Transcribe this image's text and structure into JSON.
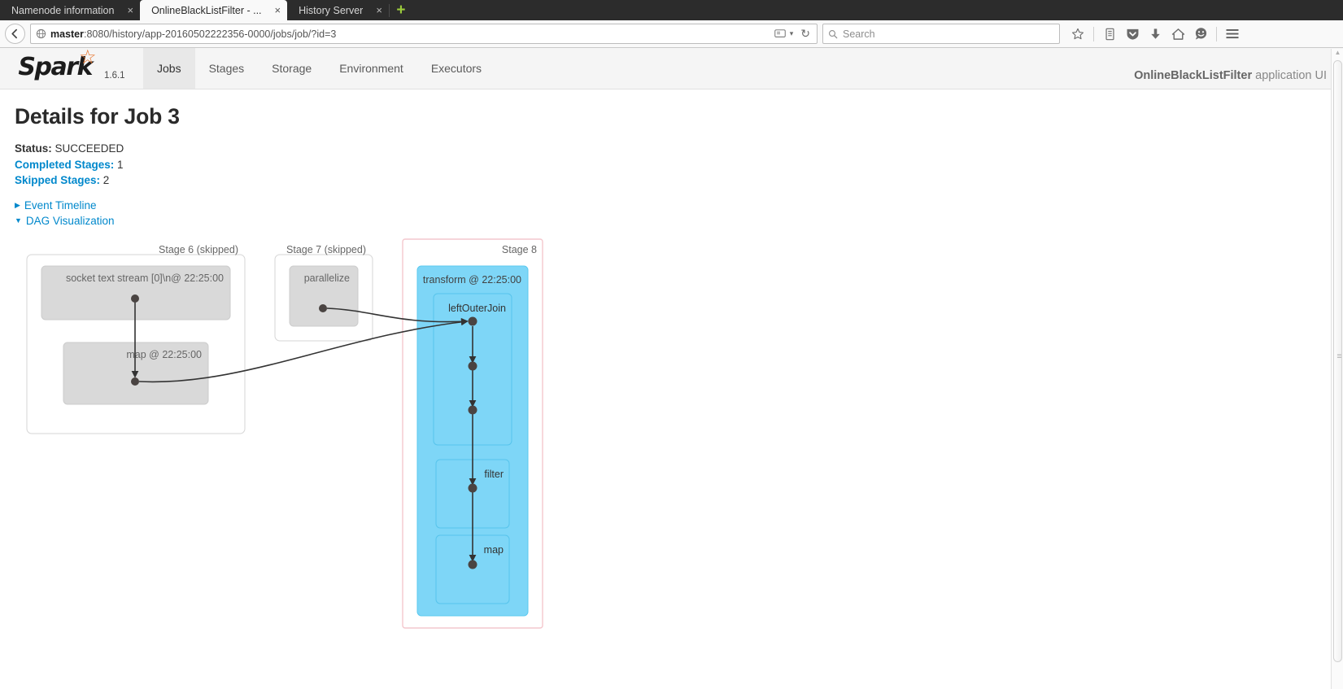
{
  "browser": {
    "tabs": [
      {
        "title": "Namenode information",
        "close": "×",
        "active": false
      },
      {
        "title": "OnlineBlackListFilter - ...",
        "close": "×",
        "active": true
      },
      {
        "title": "History Server",
        "close": "×",
        "active": false
      }
    ],
    "new_tab_label": "+",
    "back_icon": "←",
    "url_host": "master",
    "url_rest": ":8080/history/app-20160502222356-0000/jobs/job/?id=3",
    "url_globe_icon": "globe-icon",
    "reader_icon": "reader-mode-icon",
    "reader_caret": "▾",
    "reload_icon": "↻",
    "search_placeholder": "Search",
    "search_value": "",
    "toolbar_icons": [
      "bookmark-star-icon",
      "library-icon",
      "pocket-shield-icon",
      "downloads-icon",
      "home-icon",
      "chat-icon",
      "hamburger-menu-icon"
    ]
  },
  "spark": {
    "brand": "Spark",
    "version": "1.6.1",
    "nav_items": [
      {
        "label": "Jobs",
        "active": true
      },
      {
        "label": "Stages",
        "active": false
      },
      {
        "label": "Storage",
        "active": false
      },
      {
        "label": "Environment",
        "active": false
      },
      {
        "label": "Executors",
        "active": false
      }
    ],
    "app_name": "OnlineBlackListFilter",
    "app_suffix": "application UI"
  },
  "page": {
    "title": "Details for Job 3",
    "status_label": "Status:",
    "status_value": "SUCCEEDED",
    "completed_stages_label": "Completed Stages:",
    "completed_stages_value": "1",
    "skipped_stages_label": "Skipped Stages:",
    "skipped_stages_value": "2",
    "event_timeline_label": "Event Timeline",
    "dag_visualization_label": "DAG Visualization",
    "event_timeline_caret": "▶",
    "dag_caret": "▼"
  },
  "dag": {
    "stages": [
      {
        "id": "stage-6",
        "title": "Stage 6 (skipped)",
        "skipped": true,
        "nodes": [
          {
            "id": "socket-text-stream",
            "label": "socket text stream [0]\\n@ 22:25:00"
          },
          {
            "id": "map-1",
            "label": "map @ 22:25:00"
          }
        ]
      },
      {
        "id": "stage-7",
        "title": "Stage 7 (skipped)",
        "skipped": true,
        "nodes": [
          {
            "id": "parallelize",
            "label": "parallelize"
          }
        ]
      },
      {
        "id": "stage-8",
        "title": "Stage 8",
        "skipped": false,
        "nodes": [
          {
            "id": "transform",
            "label": "transform @ 22:25:00"
          },
          {
            "id": "left-outer-join",
            "label": "leftOuterJoin"
          },
          {
            "id": "filter",
            "label": "filter"
          },
          {
            "id": "map-2",
            "label": "map"
          }
        ]
      }
    ],
    "colors": {
      "skipped_fill": "#d9d9d9",
      "skipped_stroke": "#cccccc",
      "active_fill": "#7ed6f7",
      "active_stroke": "#5bc9ef",
      "stage8_border": "#f4c7cd",
      "edge": "#333333",
      "label": "#666666"
    }
  }
}
